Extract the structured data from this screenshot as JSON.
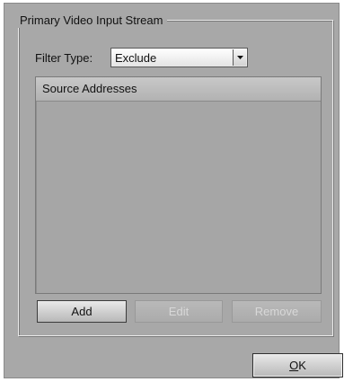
{
  "group": {
    "title": "Primary Video Input Stream"
  },
  "filter": {
    "label": "Filter Type:",
    "selected": "Exclude",
    "arrow_icon": "chevron-down-icon"
  },
  "list": {
    "column_header": "Source Addresses",
    "items": []
  },
  "buttons": {
    "add": "Add",
    "edit": "Edit",
    "remove": "Remove",
    "ok_mnemonic": "O",
    "ok_rest": "K"
  },
  "colors": {
    "dialog_bg": "#a8a8a8",
    "disabled_text": "#d8d8d8"
  }
}
